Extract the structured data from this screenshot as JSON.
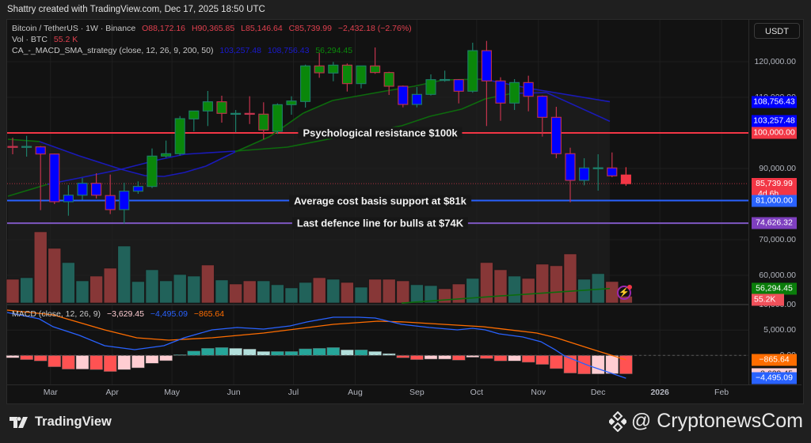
{
  "credit": "Shattry created with TradingView.com, Dec 17, 2025 18:50 UTC",
  "legend": {
    "symbol": "Bitcoin / TetherUS · 1W · Binance",
    "open": "O88,172.16",
    "high": "H90,365.85",
    "low": "L85,146.64",
    "close": "C85,739.99",
    "change": "−2,432.18 (−2.76%)",
    "vol_label": "Vol · BTC",
    "vol_value": "55.2 K",
    "strategy_label": "CA_-_MACD_SMA_strategy (close, 12, 26, 9, 200, 50)",
    "strategy_values": [
      "103,257.48",
      "108,756.43",
      "56,294.45"
    ],
    "macd_label": "MACD (close, 12, 26, 9)",
    "macd_values": [
      "−3,629.45",
      "−4,495.09",
      "−865.64"
    ]
  },
  "currency_button": "USDT",
  "annotations": [
    {
      "label": "Psychological resistance $100k",
      "price": 100000,
      "color": "#f23645"
    },
    {
      "label": "Average cost basis support at $81k",
      "price": 81000,
      "color": "#2962ff"
    },
    {
      "label": "Last defence line for bulls at $74K",
      "price": 74626.32,
      "color": "#7e57c2"
    }
  ],
  "price_axis": [
    "120,000.00",
    "110,000.00",
    "90,000.00",
    "70,000.00",
    "60,000.00"
  ],
  "price_axis_values": [
    120000,
    110000,
    90000,
    70000,
    60000
  ],
  "price_tags": [
    {
      "text": "108,756.43",
      "value": 108756.43,
      "color": "#0000ff"
    },
    {
      "text": "103,257.48",
      "value": 103257.48,
      "color": "#0000ff"
    },
    {
      "text": "100,000.00",
      "value": 100000,
      "color": "#f23645"
    },
    {
      "text": "85,739.99",
      "sub": "4d 6h",
      "value": 85739.99,
      "color": "#f23645"
    },
    {
      "text": "81,000.00",
      "value": 81000,
      "color": "#2962ff"
    },
    {
      "text": "74,626.32",
      "value": 74626.32,
      "color": "#7e3fbf"
    },
    {
      "text": "56,294.45",
      "value": 56294.45,
      "color": "#0a7d0a"
    }
  ],
  "volume_tag": {
    "text": "55.2K",
    "color": "#f0505a"
  },
  "macd_axis": [
    "10,000.00",
    "5,000.00",
    "0.00"
  ],
  "macd_axis_values": [
    10000,
    5000,
    0
  ],
  "macd_tags": [
    {
      "text": "−865.64",
      "value": -865.64,
      "color": "#ff6d00",
      "fg": "#fff"
    },
    {
      "text": "−3,629.45",
      "value": -3629.45,
      "color": "#ffcdd2",
      "fg": "#222"
    },
    {
      "text": "−4,495.09",
      "value": -4495.09,
      "color": "#2962ff",
      "fg": "#fff"
    }
  ],
  "time_axis": [
    {
      "label": "Mar",
      "date": "2025-03-01"
    },
    {
      "label": "Apr",
      "date": "2025-04-01"
    },
    {
      "label": "May",
      "date": "2025-05-01"
    },
    {
      "label": "Jun",
      "date": "2025-06-01"
    },
    {
      "label": "Jul",
      "date": "2025-07-01"
    },
    {
      "label": "Aug",
      "date": "2025-08-01"
    },
    {
      "label": "Sep",
      "date": "2025-09-01"
    },
    {
      "label": "Oct",
      "date": "2025-10-01"
    },
    {
      "label": "Nov",
      "date": "2025-11-01"
    },
    {
      "label": "Dec",
      "date": "2025-12-01"
    },
    {
      "label": "2026",
      "date": "2026-01-01"
    },
    {
      "label": "Feb",
      "date": "2026-02-01"
    }
  ],
  "footer": {
    "tradingview": "TradingView",
    "watermark": "@ CryptonewsCom"
  },
  "chart_data": {
    "type": "candlestick",
    "title": "Bitcoin / TetherUS · 1W · Binance",
    "interval": "1W",
    "first_week": "2025-02-10",
    "fields": [
      "open",
      "high",
      "low",
      "close",
      "strategy_color"
    ],
    "candles": [
      [
        96200,
        98670,
        94000,
        96070,
        "b"
      ],
      [
        96070,
        99180,
        93330,
        96200,
        "g"
      ],
      [
        96070,
        96300,
        78300,
        94070,
        "b"
      ],
      [
        94070,
        94200,
        80000,
        80670,
        "b"
      ],
      [
        80670,
        85330,
        76740,
        82510,
        "b"
      ],
      [
        82500,
        87330,
        81200,
        85840,
        "b"
      ],
      [
        85840,
        88670,
        81560,
        82500,
        "b"
      ],
      [
        82400,
        88300,
        77200,
        78450,
        "b"
      ],
      [
        78450,
        86000,
        74520,
        83630,
        "b"
      ],
      [
        83630,
        86380,
        82890,
        84960,
        "b"
      ],
      [
        84960,
        95630,
        84500,
        93490,
        "g"
      ],
      [
        93490,
        97850,
        93050,
        94160,
        "g"
      ],
      [
        94160,
        104740,
        93600,
        104000,
        "g"
      ],
      [
        103930,
        106200,
        100450,
        106160,
        "g"
      ],
      [
        106160,
        111780,
        101930,
        108740,
        "g"
      ],
      [
        108740,
        110450,
        102890,
        105490,
        "g"
      ],
      [
        105400,
        106440,
        100150,
        105490,
        "g"
      ],
      [
        105490,
        110300,
        102500,
        105400,
        "g"
      ],
      [
        105270,
        108600,
        98200,
        100820,
        "g"
      ],
      [
        100450,
        108300,
        99710,
        107930,
        "g"
      ],
      [
        107930,
        110290,
        105110,
        108960,
        "g"
      ],
      [
        108820,
        119180,
        107110,
        118820,
        "g"
      ],
      [
        118820,
        122510,
        115490,
        116890,
        "g"
      ],
      [
        116820,
        119930,
        114510,
        119040,
        "g"
      ],
      [
        119040,
        119500,
        111630,
        113850,
        "g"
      ],
      [
        113850,
        118900,
        112510,
        118820,
        "g"
      ],
      [
        118820,
        124000,
        116600,
        116960,
        "g"
      ],
      [
        116960,
        117180,
        110670,
        113110,
        "g"
      ],
      [
        113110,
        113300,
        107180,
        108000,
        "b"
      ],
      [
        108000,
        112890,
        107180,
        110820,
        "b"
      ],
      [
        110820,
        116440,
        110510,
        114960,
        "g"
      ],
      [
        114960,
        117490,
        114380,
        115000,
        "g"
      ],
      [
        114960,
        115100,
        108290,
        111710,
        "b"
      ],
      [
        111710,
        125330,
        111270,
        123110,
        "g"
      ],
      [
        123110,
        125840,
        101930,
        114600,
        "b"
      ],
      [
        114600,
        115630,
        103400,
        108380,
        "b"
      ],
      [
        108380,
        115110,
        106440,
        114150,
        "g"
      ],
      [
        114150,
        116070,
        106070,
        110290,
        "b"
      ],
      [
        110290,
        110500,
        98960,
        104380,
        "b"
      ],
      [
        104380,
        107330,
        92890,
        94160,
        "b"
      ],
      [
        94160,
        95850,
        80510,
        86670,
        "b"
      ],
      [
        86670,
        92890,
        85270,
        90160,
        "b"
      ],
      [
        90160,
        94000,
        83780,
        90200,
        "g"
      ],
      [
        90160,
        94510,
        87560,
        87940,
        "b"
      ],
      [
        88172.16,
        90365.85,
        85146.64,
        85739.99,
        "r"
      ]
    ],
    "volume_k": [
      195,
      208,
      585,
      449,
      332,
      182,
      221,
      286,
      468,
      176,
      273,
      182,
      234,
      221,
      312,
      189,
      156,
      182,
      182,
      150,
      124,
      169,
      208,
      195,
      169,
      130,
      195,
      195,
      182,
      150,
      143,
      117,
      156,
      202,
      332,
      273,
      221,
      202,
      319,
      306,
      403,
      195,
      241,
      176,
      55.2
    ],
    "volume_dir": "rtrrttrrttttttrtrrttttrtrtrrrttrrtrrtrrrrttrr",
    "strategy_lines": [
      {
        "name": "108,756.43",
        "points": [
          [
            -0.34,
            98220,
            "g"
          ],
          [
            1.93,
            97560,
            "b"
          ],
          [
            4.77,
            93560,
            "b"
          ],
          [
            7.78,
            89780,
            "b"
          ],
          [
            9.49,
            88000,
            "b"
          ],
          [
            10.85,
            87780,
            "b"
          ],
          [
            12.33,
            88890,
            "b"
          ],
          [
            13.86,
            90670,
            "b"
          ],
          [
            15.97,
            94670,
            "g"
          ],
          [
            18.4,
            98890,
            "g"
          ],
          [
            20.85,
            105560,
            "g"
          ],
          [
            22.95,
            109110,
            "g"
          ],
          [
            26.76,
            111780,
            "g"
          ],
          [
            28.8,
            113110,
            "g"
          ],
          [
            30.9,
            114890,
            "g"
          ],
          [
            33.75,
            115110,
            "b"
          ],
          [
            37.16,
            112440,
            "b"
          ],
          [
            42.84,
            108756.43,
            "b"
          ]
        ]
      },
      {
        "name": "103,257.48",
        "points": [
          [
            -0.34,
            82220,
            "g"
          ],
          [
            2.5,
            85560,
            "b"
          ],
          [
            4.77,
            87330,
            "b"
          ],
          [
            7.78,
            89780,
            "b"
          ],
          [
            10.45,
            92450,
            "b"
          ],
          [
            12.33,
            94000,
            "b"
          ],
          [
            15.97,
            94890,
            "g"
          ],
          [
            19.7,
            96000,
            "g"
          ],
          [
            23.5,
            98890,
            "g"
          ],
          [
            27.9,
            102000,
            "g"
          ],
          [
            29.94,
            104670,
            "g"
          ],
          [
            32.2,
            106670,
            "g"
          ],
          [
            33.9,
            109560,
            "g"
          ],
          [
            35.85,
            111110,
            "b"
          ],
          [
            38.3,
            111330,
            "b"
          ],
          [
            42.84,
            103257.48,
            "b"
          ]
        ]
      },
      {
        "name": "56,294.45",
        "points": [
          [
            27.9,
            52200,
            "g"
          ],
          [
            35,
            54200,
            "g"
          ],
          [
            42.84,
            56294.45,
            "g"
          ]
        ]
      }
    ],
    "macd": {
      "histogram": [
        -470,
        -830,
        -1090,
        -2240,
        -2700,
        -2700,
        -2800,
        -3170,
        -2800,
        -2450,
        -1560,
        -1040,
        160,
        880,
        1400,
        1560,
        1400,
        1250,
        780,
        780,
        780,
        1300,
        1400,
        1560,
        1100,
        1100,
        780,
        360,
        -470,
        -830,
        -730,
        -730,
        -940,
        -360,
        -620,
        -1090,
        -1090,
        -1350,
        -1770,
        -2600,
        -3480,
        -3650,
        -3650,
        -3600,
        -3629.45
      ],
      "macd_line": [
        [
          -0.4,
          8470
        ],
        [
          1.9,
          7220
        ],
        [
          2.9,
          5660
        ],
        [
          4.8,
          3950
        ],
        [
          6.6,
          1920
        ],
        [
          8.75,
          1140
        ],
        [
          10.85,
          1920
        ],
        [
          12.3,
          3480
        ],
        [
          14.3,
          5040
        ],
        [
          16.1,
          5510
        ],
        [
          18,
          5200
        ],
        [
          19.9,
          5820
        ],
        [
          21.1,
          6600
        ],
        [
          23,
          7530
        ],
        [
          24.8,
          7530
        ],
        [
          26,
          7380
        ],
        [
          27.9,
          6130
        ],
        [
          29.9,
          5510
        ],
        [
          31.9,
          5040
        ],
        [
          33,
          5350
        ],
        [
          33.9,
          5040
        ],
        [
          34.9,
          4260
        ],
        [
          36.6,
          3640
        ],
        [
          37.9,
          2700
        ],
        [
          38.9,
          1140
        ],
        [
          39.6,
          -110
        ],
        [
          41.3,
          -1980
        ],
        [
          44,
          -4495.09
        ]
      ],
      "signal_line": [
        [
          -0.4,
          8940
        ],
        [
          2.9,
          8000
        ],
        [
          6.6,
          5040
        ],
        [
          8.9,
          3480
        ],
        [
          11.2,
          3010
        ],
        [
          14.3,
          3480
        ],
        [
          18,
          4415
        ],
        [
          23,
          6130
        ],
        [
          26.2,
          6755
        ],
        [
          28.1,
          6600
        ],
        [
          30.9,
          6130
        ],
        [
          33.75,
          5660
        ],
        [
          37.6,
          4415
        ],
        [
          39,
          3480
        ],
        [
          41.3,
          1450
        ],
        [
          44,
          -865.64
        ]
      ]
    },
    "current_price": 85739.99,
    "ylim_price": [
      40000,
      131000
    ],
    "colors": {
      "g": "#0a870a",
      "b": "#0000ff",
      "r": "#f23645",
      "up_border": "#1d7f6a",
      "down_border": "#c2334d",
      "macd": "#2962ff",
      "signal": "#ff6d00"
    }
  }
}
